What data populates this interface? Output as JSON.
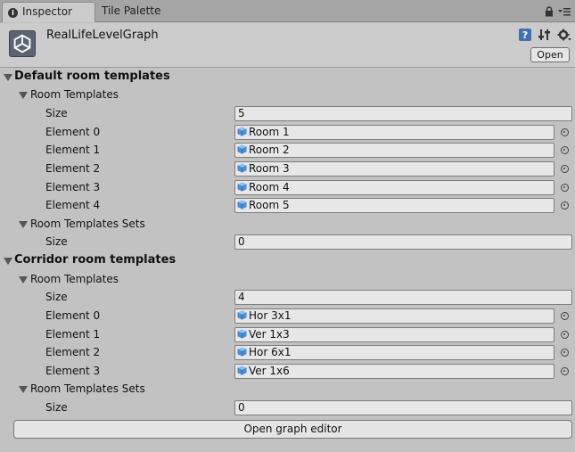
{
  "tabs": [
    {
      "label": "Inspector",
      "icon": "info-icon"
    },
    {
      "label": "Tile Palette"
    }
  ],
  "header": {
    "title": "RealLifeLevelGraph",
    "open_label": "Open",
    "icons": [
      "help-icon",
      "preset-icon",
      "settings-icon"
    ]
  },
  "sections": [
    {
      "title": "Default room templates",
      "room_templates_label": "Room Templates",
      "size_label": "Size",
      "size": "5",
      "elements": [
        {
          "label": "Element 0",
          "value": "Room 1"
        },
        {
          "label": "Element 1",
          "value": "Room 2"
        },
        {
          "label": "Element 2",
          "value": "Room 3"
        },
        {
          "label": "Element 3",
          "value": "Room 4"
        },
        {
          "label": "Element 4",
          "value": "Room 5"
        }
      ],
      "sets_label": "Room Templates Sets",
      "sets_size_label": "Size",
      "sets_size": "0"
    },
    {
      "title": "Corridor room templates",
      "room_templates_label": "Room Templates",
      "size_label": "Size",
      "size": "4",
      "elements": [
        {
          "label": "Element 0",
          "value": "Hor 3x1"
        },
        {
          "label": "Element 1",
          "value": "Ver 1x3"
        },
        {
          "label": "Element 2",
          "value": "Hor 6x1"
        },
        {
          "label": "Element 3",
          "value": "Ver 1x6"
        }
      ],
      "sets_label": "Room Templates Sets",
      "sets_size_label": "Size",
      "sets_size": "0"
    }
  ],
  "bottom_button": "Open graph editor",
  "colors": {
    "background": "#c2c2c2",
    "tabbar": "#a5a5a5",
    "field": "#e7e7e7",
    "cube_blue": "#4a90d9"
  }
}
